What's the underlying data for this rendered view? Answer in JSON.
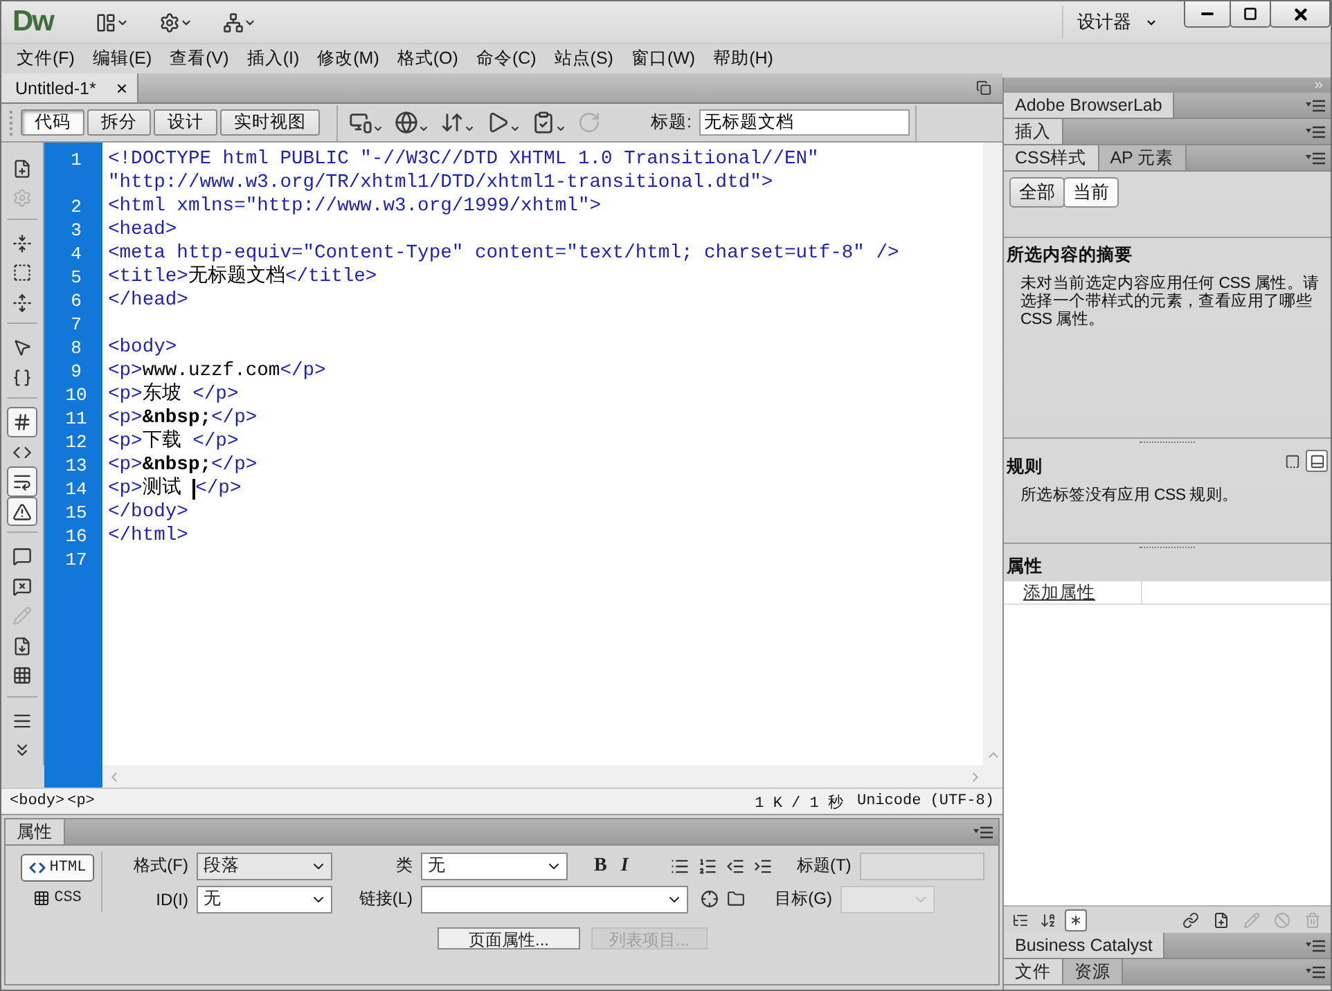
{
  "app": {
    "logo": "Dw",
    "workspace": "设计器"
  },
  "menu": [
    "文件(F)",
    "编辑(E)",
    "查看(V)",
    "插入(I)",
    "修改(M)",
    "格式(O)",
    "命令(C)",
    "站点(S)",
    "窗口(W)",
    "帮助(H)"
  ],
  "document_tabs": [
    {
      "label": "Untitled-1*",
      "selected": true
    }
  ],
  "view_buttons": [
    {
      "label": "代码",
      "selected": true
    },
    {
      "label": "拆分",
      "selected": false
    },
    {
      "label": "设计",
      "selected": false
    },
    {
      "label": "实时视图",
      "selected": false
    }
  ],
  "doc_tools": [
    {
      "disabled": false
    },
    {
      "disabled": false
    },
    {
      "disabled": false
    },
    {
      "disabled": false
    },
    {
      "disabled": false
    },
    {
      "disabled": true
    }
  ],
  "title_field": {
    "label": "标题:",
    "value": "无标题文档"
  },
  "left_toolbar": [
    {
      "selected": false,
      "disabled": false
    },
    {
      "selected": false,
      "disabled": true
    },
    {
      "selected": false,
      "disabled": false
    },
    {
      "selected": false,
      "disabled": false
    },
    {
      "selected": false,
      "disabled": false
    },
    {
      "selected": false,
      "disabled": false
    },
    {
      "selected": false,
      "disabled": false
    },
    {
      "selected": true,
      "disabled": false
    },
    {
      "selected": false,
      "disabled": false
    },
    {
      "selected": true,
      "disabled": false
    },
    {
      "selected": true,
      "disabled": false
    },
    {
      "selected": false,
      "disabled": false
    },
    {
      "selected": false,
      "disabled": false
    },
    {
      "selected": false,
      "disabled": true
    },
    {
      "selected": false,
      "disabled": false
    },
    {
      "selected": false,
      "disabled": false
    },
    {
      "selected": false,
      "disabled": false
    },
    {
      "selected": false,
      "disabled": false
    }
  ],
  "code_lines": [
    {
      "number": "1",
      "segments": [
        {
          "kind": "tag",
          "text": "<!DOCTYPE html PUBLIC \"-//W3C//DTD XHTML 1.0 Transitional//EN\""
        }
      ]
    },
    {
      "segments": [
        {
          "kind": "tag",
          "text": "\"http://www.w3.org/TR/xhtml1/DTD/xhtml1-transitional.dtd\">"
        }
      ]
    },
    {
      "number": "2",
      "segments": [
        {
          "kind": "tag",
          "text": "<html xmlns=\"http://www.w3.org/1999/xhtml\">"
        }
      ]
    },
    {
      "number": "3",
      "segments": [
        {
          "kind": "tag",
          "text": "<head>"
        }
      ]
    },
    {
      "number": "4",
      "segments": [
        {
          "kind": "tag",
          "text": "<meta http-equiv=\"Content-Type\" content=\"text/html; charset=utf-8\" />"
        }
      ]
    },
    {
      "number": "5",
      "segments": [
        {
          "kind": "tag",
          "text": "<title>"
        },
        {
          "kind": "text",
          "text": "无标题文档"
        },
        {
          "kind": "tag",
          "text": "</title>"
        }
      ]
    },
    {
      "number": "6",
      "segments": [
        {
          "kind": "tag",
          "text": "</head>"
        }
      ]
    },
    {
      "number": "7"
    },
    {
      "number": "8",
      "segments": [
        {
          "kind": "tag",
          "text": "<body>"
        }
      ]
    },
    {
      "number": "9",
      "segments": [
        {
          "kind": "tag",
          "text": "<p>"
        },
        {
          "kind": "text",
          "text": "www.uzzf.com"
        },
        {
          "kind": "tag",
          "text": "</p>"
        }
      ]
    },
    {
      "number": "10",
      "segments": [
        {
          "kind": "tag",
          "text": "<p>"
        },
        {
          "kind": "text",
          "text": "东坡 "
        },
        {
          "kind": "tag",
          "text": "</p>"
        }
      ]
    },
    {
      "number": "11",
      "segments": [
        {
          "kind": "tag",
          "text": "<p>"
        },
        {
          "kind": "entity",
          "text": "&nbsp;"
        },
        {
          "kind": "tag",
          "text": "</p>"
        }
      ]
    },
    {
      "number": "12",
      "segments": [
        {
          "kind": "tag",
          "text": "<p>"
        },
        {
          "kind": "text",
          "text": "下载 "
        },
        {
          "kind": "tag",
          "text": "</p>"
        }
      ]
    },
    {
      "number": "13",
      "segments": [
        {
          "kind": "tag",
          "text": "<p>"
        },
        {
          "kind": "entity",
          "text": "&nbsp;"
        },
        {
          "kind": "tag",
          "text": "</p>"
        }
      ]
    },
    {
      "number": "14",
      "segments": [
        {
          "kind": "tag",
          "text": "<p>"
        },
        {
          "kind": "text",
          "text": "测试 "
        },
        {
          "kind": "caret"
        },
        {
          "kind": "tag",
          "text": "</p>"
        }
      ]
    },
    {
      "number": "15",
      "segments": [
        {
          "kind": "tag",
          "text": "</body>"
        }
      ]
    },
    {
      "number": "16",
      "segments": [
        {
          "kind": "tag",
          "text": "</html>"
        }
      ]
    },
    {
      "number": "17"
    }
  ],
  "status_bar": {
    "tags": [
      "<body>",
      "<p>"
    ],
    "size": "1 K / 1 秒",
    "encoding": "Unicode (UTF-8)"
  },
  "properties": {
    "title": "属性",
    "mode_buttons": [
      {
        "label": "HTML",
        "selected": true
      },
      {
        "label": "CSS",
        "selected": false
      }
    ],
    "format": {
      "label": "格式(F)",
      "value": "段落"
    },
    "id": {
      "label": "ID(I)",
      "value": "无"
    },
    "class": {
      "label": "类",
      "value": "无"
    },
    "link": {
      "label": "链接(L)"
    },
    "style_buttons": [
      "B",
      "I"
    ],
    "heading": {
      "label": "标题(T)",
      "disabled": true
    },
    "target": {
      "label": "目标(G)",
      "disabled": true
    },
    "buttons": [
      {
        "label": "页面属性...",
        "disabled": false
      },
      {
        "label": "列表项目...",
        "disabled": true
      }
    ]
  },
  "right_panel": {
    "browserlab": {
      "title": "Adobe BrowserLab"
    },
    "insert": {
      "title": "插入"
    },
    "css_tabs": [
      {
        "label": "CSS样式",
        "selected": true
      },
      {
        "label": "AP 元素",
        "selected": false
      }
    ],
    "css_modes": [
      {
        "label": "全部",
        "selected": false
      },
      {
        "label": "当前",
        "selected": true
      }
    ],
    "summary": {
      "title": "所选内容的摘要",
      "text": "未对当前选定内容应用任何 CSS 属性。请选择一个带样式的元素，查看应用了哪些 CSS 属性。"
    },
    "rules": {
      "title": "规则",
      "text": "所选标签没有应用 CSS 规则。",
      "views": [
        {
          "selected": false
        },
        {
          "selected": true
        }
      ]
    },
    "attributes": {
      "title": "属性",
      "link": "添加属性"
    },
    "list_views": [
      {
        "selected": false
      },
      {
        "selected": false
      },
      {
        "selected": true
      }
    ],
    "business_catalyst": {
      "title": "Business Catalyst"
    },
    "file_tabs": [
      {
        "label": "文件",
        "selected": true
      },
      {
        "label": "资源",
        "selected": false
      }
    ]
  }
}
